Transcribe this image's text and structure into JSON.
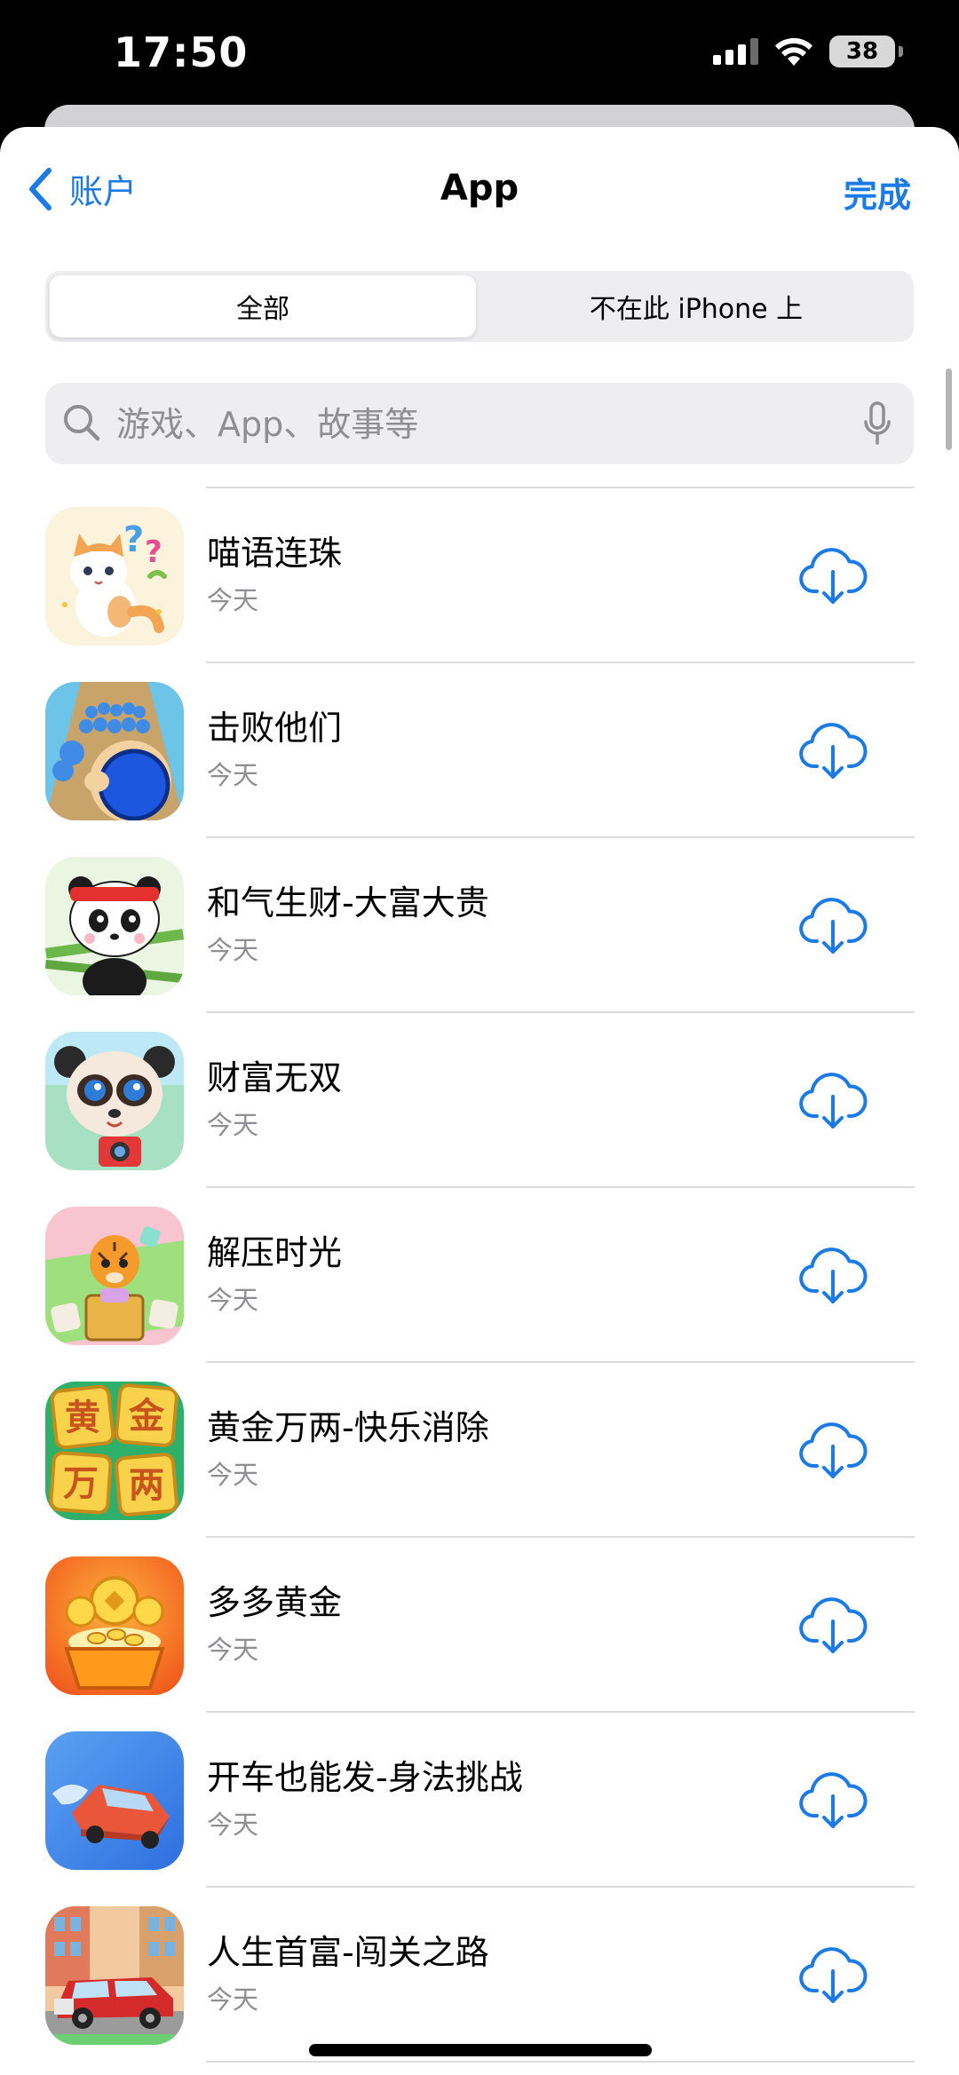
{
  "status_bar": {
    "time": "17:50",
    "battery": "38"
  },
  "nav": {
    "back_label": "账户",
    "title": "App",
    "done_label": "完成"
  },
  "segmented": {
    "all_label": "全部",
    "not_on_device_label": "不在此 iPhone 上",
    "selected": "全部"
  },
  "search": {
    "placeholder": "游戏、App、故事等",
    "value": ""
  },
  "apps": [
    {
      "name": "喵语连珠",
      "date": "今天",
      "icon": "cat-icon"
    },
    {
      "name": "击败他们",
      "date": "今天",
      "icon": "crowd-icon"
    },
    {
      "name": "和气生财-大富大贵",
      "date": "今天",
      "icon": "panda-headband-icon"
    },
    {
      "name": "财富无双",
      "date": "今天",
      "icon": "panda-camera-icon"
    },
    {
      "name": "解压时光",
      "date": "今天",
      "icon": "tiger-icon"
    },
    {
      "name": "黄金万两-快乐消除",
      "date": "今天",
      "icon": "gold-tiles-icon"
    },
    {
      "name": "多多黄金",
      "date": "今天",
      "icon": "gold-coins-icon"
    },
    {
      "name": "开车也能发-身法挑战",
      "date": "今天",
      "icon": "car-icon"
    },
    {
      "name": "人生首富-闯关之路",
      "date": "今天",
      "icon": "luxury-car-icon"
    }
  ],
  "icon_chars": {
    "gold_tiles": [
      "黄",
      "金",
      "万",
      "两"
    ]
  },
  "colors": {
    "accent": "#1a7ae6",
    "secondary_text": "#8e8e93",
    "control_bg": "#eeeef0"
  }
}
